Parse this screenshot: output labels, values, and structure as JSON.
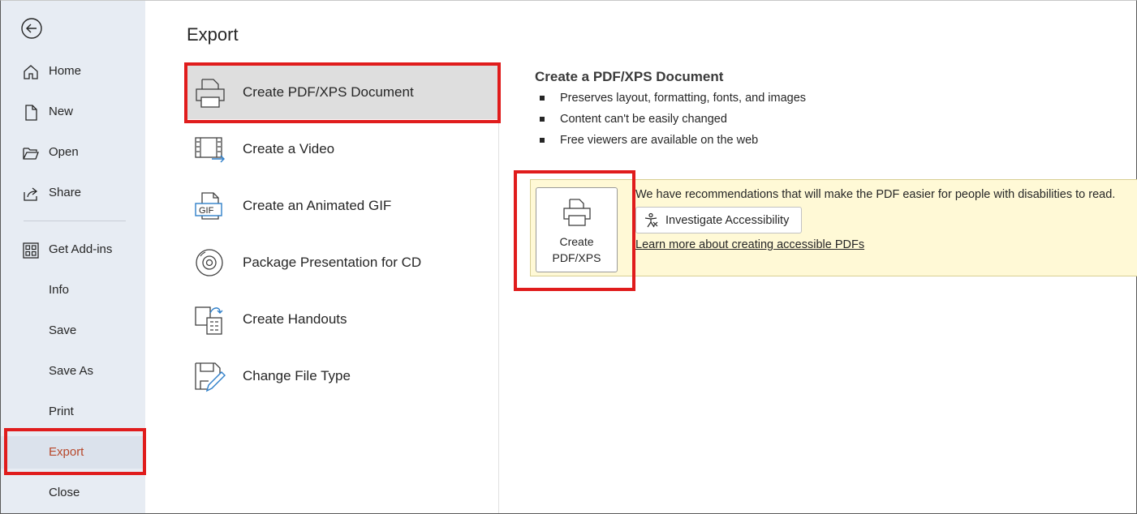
{
  "sidebar": {
    "back_icon": "back-arrow-icon",
    "items": [
      {
        "label": "Home",
        "icon": "home-icon"
      },
      {
        "label": "New",
        "icon": "new-document-icon"
      },
      {
        "label": "Open",
        "icon": "folder-open-icon"
      },
      {
        "label": "Share",
        "icon": "share-icon"
      },
      {
        "label": "Get Add-ins",
        "icon": "add-ins-grid-icon"
      },
      {
        "label": "Info"
      },
      {
        "label": "Save"
      },
      {
        "label": "Save As"
      },
      {
        "label": "Print"
      },
      {
        "label": "Export",
        "active": true
      },
      {
        "label": "Close"
      }
    ]
  },
  "main": {
    "title": "Export",
    "options": [
      {
        "label": "Create PDF/XPS Document",
        "icon": "pdf-printer-icon",
        "selected": true
      },
      {
        "label": "Create a Video",
        "icon": "video-film-icon"
      },
      {
        "label": "Create an Animated GIF",
        "icon": "gif-icon",
        "badge": "GIF"
      },
      {
        "label": "Package Presentation for CD",
        "icon": "cd-disc-icon"
      },
      {
        "label": "Create Handouts",
        "icon": "handouts-icon"
      },
      {
        "label": "Change File Type",
        "icon": "change-file-type-icon"
      }
    ]
  },
  "detail": {
    "title": "Create a PDF/XPS Document",
    "bullets": [
      "Preserves layout, formatting, fonts, and images",
      "Content can't be easily changed",
      "Free viewers are available on the web"
    ],
    "create_button": {
      "line1": "Create",
      "line2": "PDF/XPS"
    },
    "banner_text": "We have recommendations that will make the PDF easier for people with disabilities to read.",
    "investigate_button": "Investigate Accessibility",
    "learn_link": "Learn more about creating accessible PDFs"
  },
  "colors": {
    "sidebar_bg": "#e7ecf3",
    "active_text": "#b7472a",
    "banner_bg": "#fff9d6",
    "highlight": "#e01c1c",
    "selected_bg": "#dedede"
  }
}
